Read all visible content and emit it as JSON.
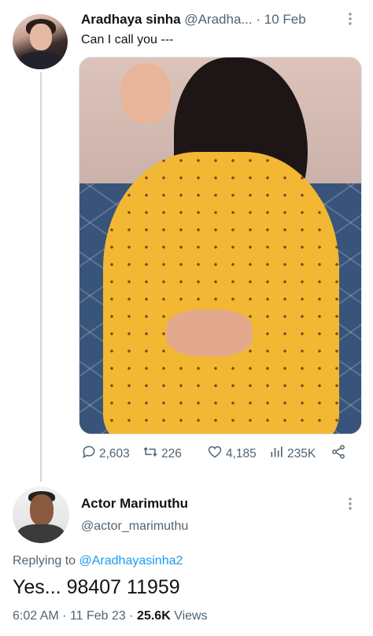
{
  "tweet": {
    "author_name": "Aradhaya sinha",
    "author_handle": "@Aradha...",
    "separator": "·",
    "date": "10 Feb",
    "text": "Can I call you ---",
    "more_icon": "more-vertical-icon",
    "media_alt": "photo",
    "stats": {
      "replies": "2,603",
      "retweets": "226",
      "likes": "4,185",
      "views": "235K"
    }
  },
  "reply": {
    "author_name": "Actor Marimuthu",
    "author_handle": "@actor_marimuthu",
    "replying_label": "Replying to",
    "replying_handle": "@Aradhayasinha2",
    "text": "Yes... 98407 11959",
    "time": "6:02 AM",
    "sep1": "·",
    "date": "11 Feb 23",
    "sep2": "·",
    "views_count": "25.6K",
    "views_label": "Views"
  },
  "colors": {
    "accent": "#1d9bf0",
    "text": "#0f1419",
    "muted": "#536471"
  }
}
